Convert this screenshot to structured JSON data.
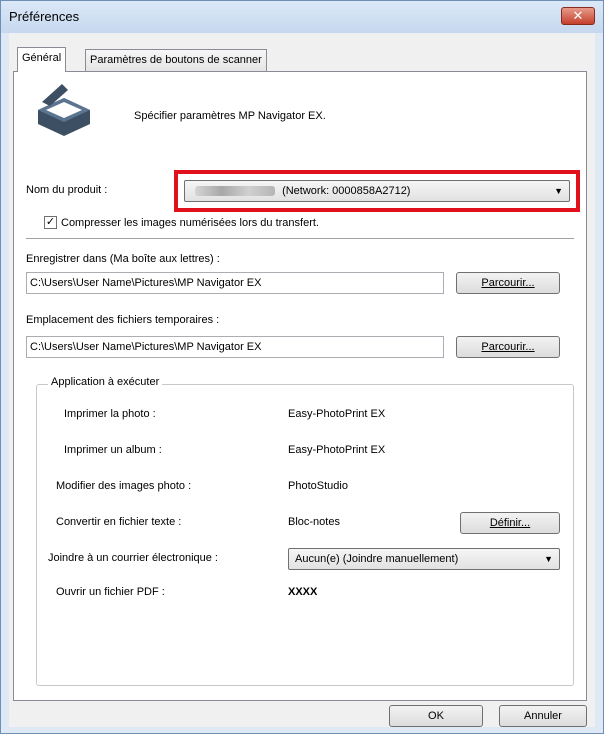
{
  "window": {
    "title": "Préférences",
    "close_label": "✕"
  },
  "tabs": [
    {
      "label": "Général"
    },
    {
      "label": "Paramètres de boutons de scanner"
    }
  ],
  "general": {
    "intro_text": "Spécifier paramètres MP Navigator EX.",
    "product_label": "Nom du produit :",
    "product_value": "(Network: 0000858A2712)",
    "compress_label": "Compresser les images numérisées lors du transfert.",
    "compress_checked": "✓",
    "save_label": "Enregistrer dans (Ma boîte aux lettres) :",
    "save_path": "C:\\Users\\User Name\\Pictures\\MP Navigator EX",
    "browse_label": "Parcourir...",
    "temp_label": "Emplacement des fichiers temporaires :",
    "temp_path": "C:\\Users\\User Name\\Pictures\\MP Navigator EX",
    "browse2_label": "Parcourir..."
  },
  "apps": {
    "group_title": "Application à exécuter",
    "rows": [
      {
        "label": "Imprimer la photo :",
        "value": "Easy-PhotoPrint EX"
      },
      {
        "label": "Imprimer un album :",
        "value": "Easy-PhotoPrint EX"
      },
      {
        "label": "Modifier des images photo :",
        "value": "PhotoStudio"
      },
      {
        "label": "Convertir en fichier texte :",
        "value": "Bloc-notes"
      },
      {
        "label": "Joindre à un courrier électronique :",
        "value": "Aucun(e) (Joindre manuellement)"
      },
      {
        "label": "Ouvrir un fichier PDF :",
        "value": "XXXX"
      }
    ],
    "define_label": "Définir..."
  },
  "footer": {
    "ok_label": "OK",
    "cancel_label": "Annuler"
  },
  "colors": {
    "highlight": "#e0101c",
    "window_frame": "#6f8fb5"
  }
}
